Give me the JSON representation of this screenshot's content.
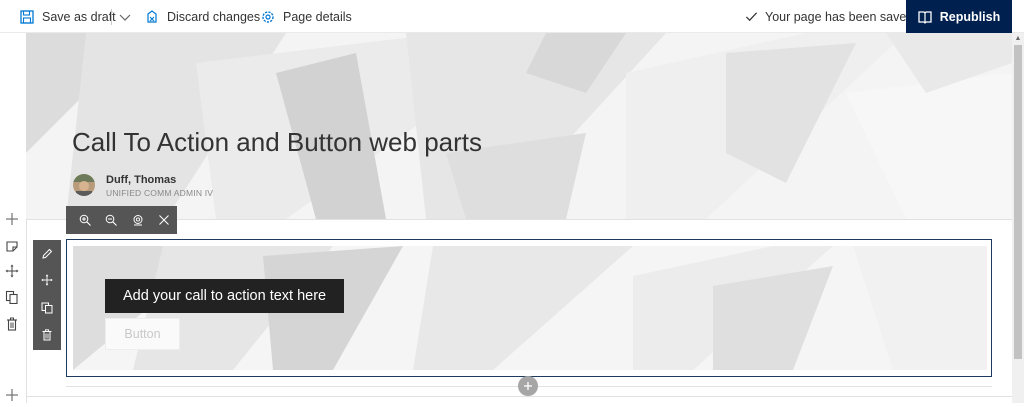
{
  "command_bar": {
    "save_draft": "Save as draft",
    "discard": "Discard changes",
    "page_details": "Page details",
    "status": "Your page has been saved",
    "republish": "Republish"
  },
  "header": {
    "title": "Call To Action and Button web parts",
    "author_name": "Duff, Thomas",
    "author_role": "UNIFIED COMM ADMIN IV"
  },
  "webpart": {
    "cta_text": "Add your call to action text here",
    "button_label": "Button"
  },
  "colors": {
    "republish_bg": "#002050",
    "toolbar_bg": "#555555",
    "selected_border": "#1e3a5f"
  },
  "icons": {
    "save": "save-icon",
    "discard": "discard-icon",
    "details": "gear-icon",
    "check": "check-icon",
    "republish": "book-icon",
    "zoom_in": "zoom-in-icon",
    "zoom_out": "zoom-out-icon",
    "reset": "reset-zoom-icon",
    "close": "close-icon",
    "edit": "pencil-icon",
    "move": "move-icon",
    "duplicate": "duplicate-icon",
    "delete": "trash-icon",
    "add": "plus-icon"
  }
}
